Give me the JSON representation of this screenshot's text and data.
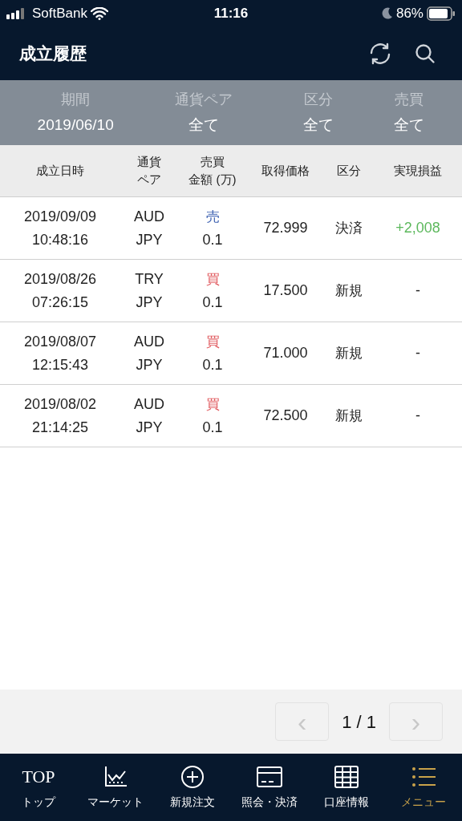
{
  "status_bar": {
    "carrier": "SoftBank",
    "time": "11:16",
    "battery": "86%"
  },
  "header": {
    "title": "成立履歴"
  },
  "filters": [
    {
      "label": "期間",
      "value": "2019/06/10"
    },
    {
      "label": "通貨ペア",
      "value": "全て"
    },
    {
      "label": "区分",
      "value": "全て"
    },
    {
      "label": "売買",
      "value": "全て"
    }
  ],
  "table": {
    "columns": [
      [
        "成立日時"
      ],
      [
        "通貨",
        "ペア"
      ],
      [
        "売買",
        "金額 (万)"
      ],
      [
        "取得価格"
      ],
      [
        "区分"
      ],
      [
        "実現損益"
      ]
    ],
    "rows": [
      {
        "date": "2019/09/09",
        "time": "10:48:16",
        "base": "AUD",
        "quote": "JPY",
        "side": {
          "text": "売",
          "color": "#3b5fb0"
        },
        "amount": "0.1",
        "price": "72.999",
        "type": "決済",
        "pl": "+2,008",
        "pl_positive": true
      },
      {
        "date": "2019/08/26",
        "time": "07:26:15",
        "base": "TRY",
        "quote": "JPY",
        "side": {
          "text": "買",
          "color": "#e0565b"
        },
        "amount": "0.1",
        "price": "17.500",
        "type": "新規",
        "pl": "-",
        "pl_positive": false
      },
      {
        "date": "2019/08/07",
        "time": "12:15:43",
        "base": "AUD",
        "quote": "JPY",
        "side": {
          "text": "買",
          "color": "#e0565b"
        },
        "amount": "0.1",
        "price": "71.000",
        "type": "新規",
        "pl": "-",
        "pl_positive": false
      },
      {
        "date": "2019/08/02",
        "time": "21:14:25",
        "base": "AUD",
        "quote": "JPY",
        "side": {
          "text": "買",
          "color": "#e0565b"
        },
        "amount": "0.1",
        "price": "72.500",
        "type": "新規",
        "pl": "-",
        "pl_positive": false
      }
    ]
  },
  "pagination": {
    "prev": {
      "label": "‹",
      "disabled": true
    },
    "page": "1 / 1",
    "next": {
      "label": "›",
      "disabled": true
    }
  },
  "nav": [
    {
      "kind": "top",
      "logo": "TOP",
      "label": "トップ",
      "selected": false
    },
    {
      "kind": "chart",
      "label": "マーケット",
      "selected": false
    },
    {
      "kind": "plus",
      "label": "新規注文",
      "selected": false
    },
    {
      "kind": "card",
      "label": "照会・決済",
      "selected": false
    },
    {
      "kind": "grid",
      "label": "口座情報",
      "selected": false
    },
    {
      "kind": "list",
      "label": "メニュー",
      "selected": true
    }
  ]
}
